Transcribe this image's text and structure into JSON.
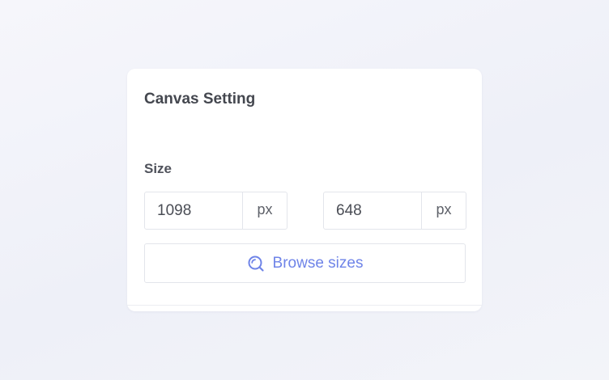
{
  "panel": {
    "title": "Canvas Setting",
    "size_label": "Size",
    "width": {
      "value": "1098",
      "unit": "px"
    },
    "height": {
      "value": "648",
      "unit": "px"
    },
    "browse_button": {
      "label": "Browse sizes",
      "icon": "search-icon"
    }
  },
  "colors": {
    "accent": "#6f84e8",
    "text": "#44474f",
    "border": "#e3e5eb",
    "background": "#f1f2f8"
  }
}
